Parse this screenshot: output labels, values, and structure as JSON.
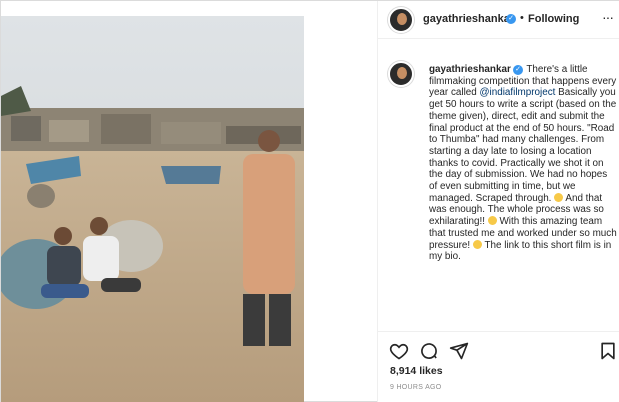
{
  "post": {
    "username": "gayathrieshankar",
    "verified_glyph": "✓",
    "separator": "•",
    "follow_status": "Following",
    "more_label": "···",
    "caption": {
      "p1": "There's a little filmmaking competition that happens every year called ",
      "mention": "@indiafilmproject",
      "p2": " Basically you get 50 hours to write a script (based on the theme given), direct, edit and submit the final product at the end of 50 hours. \"Road to Thumba\" had many challenges. From starting a day late to losing a location thanks to covid. Practically we shot it on the day of submission. We had no hopes of even submitting in time, but we managed. Scraped through. ",
      "p3": " And that was enough. The whole process was so exhilarating!! ",
      "p4": " With this amazing team that trusted me and worked under so much pressure! ",
      "p5": " The link to this short film is in my bio."
    },
    "likes": "8,914 likes",
    "time_ago": "9 HOURS AGO"
  },
  "icons": {
    "like": "heart-icon",
    "comment": "comment-icon",
    "share": "share-icon",
    "save": "bookmark-icon",
    "verified": "verified-badge-icon",
    "more": "more-options-icon"
  },
  "colors": {
    "verified_blue": "#3897f0",
    "mention_blue": "#00376b",
    "muted_gray": "#8e8e8e",
    "border": "#dbdbdb"
  }
}
